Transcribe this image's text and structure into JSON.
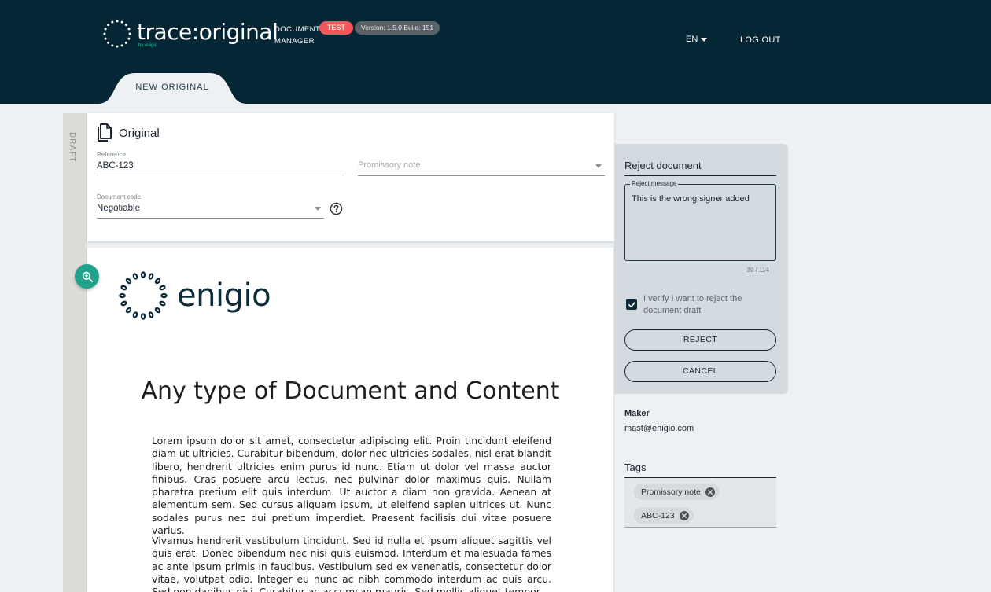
{
  "header": {
    "brand": "trace:original",
    "brand_sub": "by enigio",
    "doc_line1": "DOCUMENT",
    "doc_line2": "MANAGER",
    "env_badge": "TEST",
    "version": "Version: 1.5.0 Build: 151",
    "language": "EN",
    "logout": "LOG OUT",
    "active_tab": "NEW ORIGINAL"
  },
  "sidebar": {
    "status_label": "DRAFT"
  },
  "form": {
    "title": "Original",
    "reference": {
      "label": "Reference",
      "value": "ABC-123"
    },
    "type": {
      "placeholder": "Promissory note"
    },
    "document_code": {
      "label": "Document code",
      "value": "Negotiable"
    }
  },
  "preview": {
    "logo_text": "enigio",
    "heading": "Any type of Document and Content",
    "paragraph1": "Lorem ipsum dolor sit amet, consectetur adipiscing elit. Proin tincidunt eleifend diam ut ultricies. Curabitur bibendum, dolor nec ultricies sodales, nisl erat blandit libero, hendrerit ultricies enim purus id nunc. Etiam ut dolor vel massa auctor finibus. Cras posuere arcu lectus, nec pulvinar dolor maximus quis. Nullam pharetra pretium elit quis interdum. Ut auctor a diam non gravida. Aenean at elementum sem. Sed cursus aliquam ipsum, ut eleifend sapien ultrices ut. Nunc sodales purus nec dui pretium imperdiet. Praesent facilisis dui vitae posuere varius.",
    "paragraph2": "Vivamus hendrerit vestibulum tincidunt. Sed id nulla et ipsum aliquet sagittis vel quis erat. Donec bibendum nec nisi quis euismod. Interdum et malesuada fames ac ante ipsum primis in faucibus. Vestibulum sed ex venenatis, consectetur dolor vitae, volutpat odio. Integer eu nunc ac nibh commodo interdum ac quis arcu. Sed non dapibus nisi. Curabitur ac accumsan mauris. Sed mollis aliquet tempor."
  },
  "reject": {
    "title": "Reject document",
    "message_label": "Reject message",
    "message": "This is the wrong signer added",
    "counter": "30 / 114",
    "verify_text": "I verify I want to reject the document draft",
    "verify_checked": true,
    "reject_button": "REJECT",
    "cancel_button": "CANCEL"
  },
  "maker": {
    "label": "Maker",
    "value": "mast@enigio.com"
  },
  "tags": {
    "title": "Tags",
    "items": [
      "Promissory note",
      "ABC-123"
    ]
  },
  "colors": {
    "header_bg": "#052635",
    "accent": "#22a28a",
    "test_badge": "#f2575a",
    "panel_bg": "#d3dae0"
  },
  "icons": [
    "logo-ring-icon",
    "caret-down-icon",
    "document-copy-icon",
    "help-icon",
    "zoom-in-icon",
    "checkmark-icon",
    "close-circle-icon"
  ]
}
